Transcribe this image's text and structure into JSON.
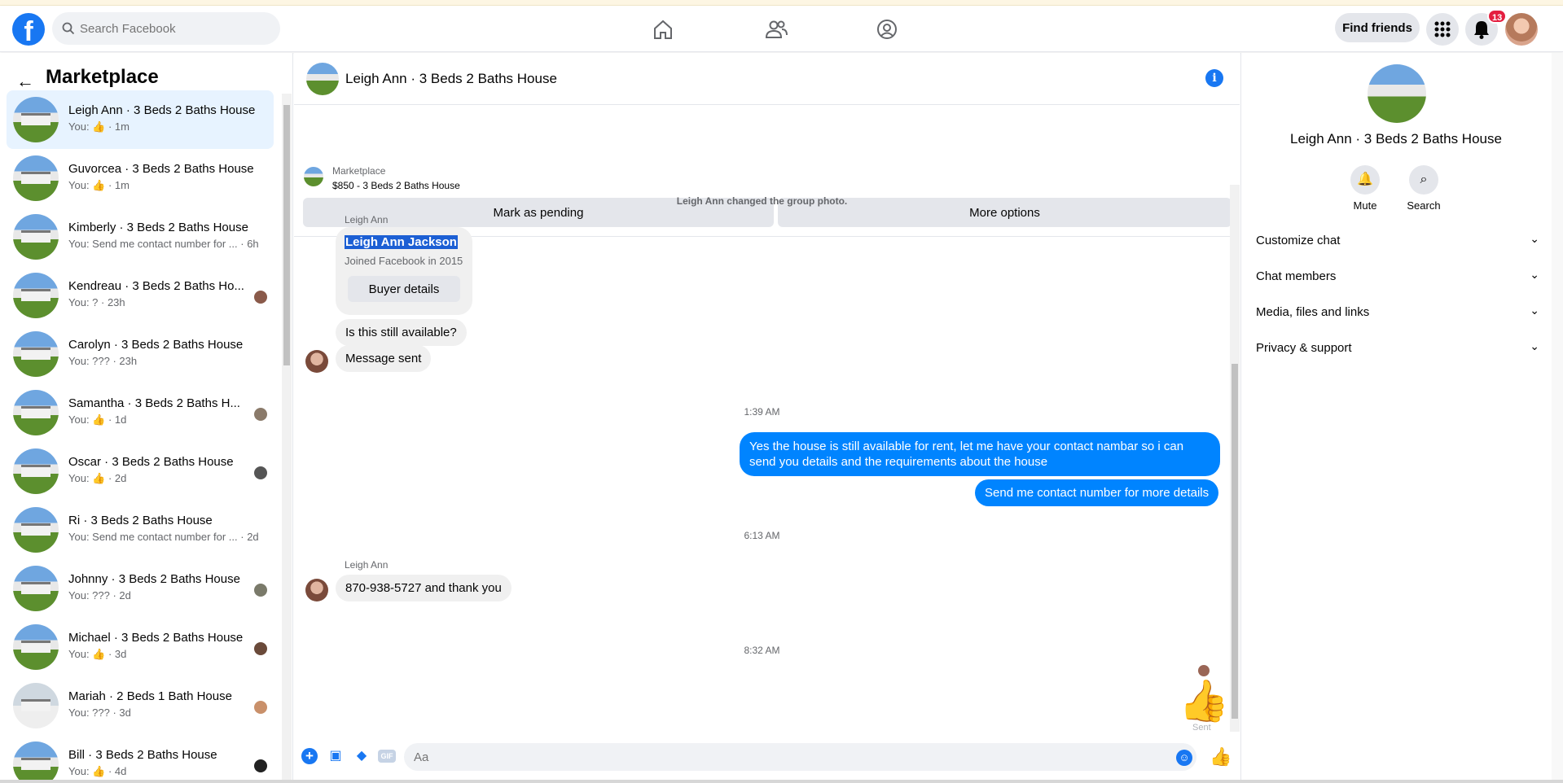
{
  "header": {
    "logo": "f",
    "search_placeholder": "Search Facebook",
    "find_friends": "Find friends",
    "notif_count": "13",
    "icons": [
      "home-icon",
      "friends-icon",
      "groups-icon",
      "grid-menu-icon",
      "bell-icon"
    ]
  },
  "sidebar": {
    "title": "Marketplace",
    "conversations": [
      {
        "name": "Leigh Ann · 3 Beds 2 Baths House",
        "sub": "You: 👍 · 1m",
        "active": true
      },
      {
        "name": "Guvorcea · 3 Beds 2 Baths House",
        "sub": "You: 👍 · 1m"
      },
      {
        "name": "Kimberly · 3 Beds 2 Baths House",
        "sub": "You: Send me contact number for ... · 6h"
      },
      {
        "name": "Kendreau · 3 Beds 2 Baths Ho...",
        "sub": "You: ? · 23h"
      },
      {
        "name": "Carolyn · 3 Beds 2 Baths House",
        "sub": "You: ??? · 23h"
      },
      {
        "name": "Samantha · 3 Beds 2 Baths H...",
        "sub": "You: 👍 · 1d"
      },
      {
        "name": "Oscar · 3 Beds 2 Baths House",
        "sub": "You: 👍 · 2d"
      },
      {
        "name": "Ri · 3 Beds 2 Baths House",
        "sub": "You: Send me contact number for ... · 2d"
      },
      {
        "name": "Johnny · 3 Beds 2 Baths House",
        "sub": "You: ??? · 2d"
      },
      {
        "name": "Michael · 3 Beds 2 Baths House",
        "sub": "You: 👍 · 3d"
      },
      {
        "name": "Mariah · 2 Beds 1 Bath House",
        "sub": "You: ??? · 3d"
      },
      {
        "name": "Bill · 3 Beds 2 Baths House",
        "sub": "You: 👍 · 4d"
      }
    ]
  },
  "chat": {
    "title": "Leigh Ann · 3 Beds 2 Baths House",
    "marketplace_label": "Marketplace",
    "listing": "$850 - 3 Beds 2 Baths House",
    "mark_pending": "Mark as pending",
    "more_options": "More options",
    "system_photo": "Leigh Ann changed the group photo.",
    "sender_name": "Leigh Ann",
    "card_name": "Leigh Ann Jackson",
    "card_joined": "Joined Facebook in 2015",
    "buyer_details": "Buyer details",
    "msg_available": "Is this still available?",
    "msg_sent": "Message sent",
    "time1": "1:39 AM",
    "out1": "Yes the house is still available for rent, let me have your contact nambar so i can send you details and the requirements about the house",
    "out2": "Send me contact number for more details",
    "time2": "6:13 AM",
    "in_phone": "870-938-5727 and thank you",
    "time3": "8:32 AM",
    "sent_label": "Sent",
    "composer_placeholder": "Aa",
    "composer_icons": [
      "plus-icon",
      "photo-icon",
      "sticker-icon",
      "gif-icon"
    ]
  },
  "right": {
    "title": "Leigh Ann · 3 Beds 2 Baths House",
    "mute": "Mute",
    "search": "Search",
    "sections": [
      "Customize chat",
      "Chat members",
      "Media, files and links",
      "Privacy & support"
    ]
  },
  "colors": {
    "brand": "#1877f2",
    "outgoing": "#0084ff",
    "badge": "#e41e3f"
  }
}
